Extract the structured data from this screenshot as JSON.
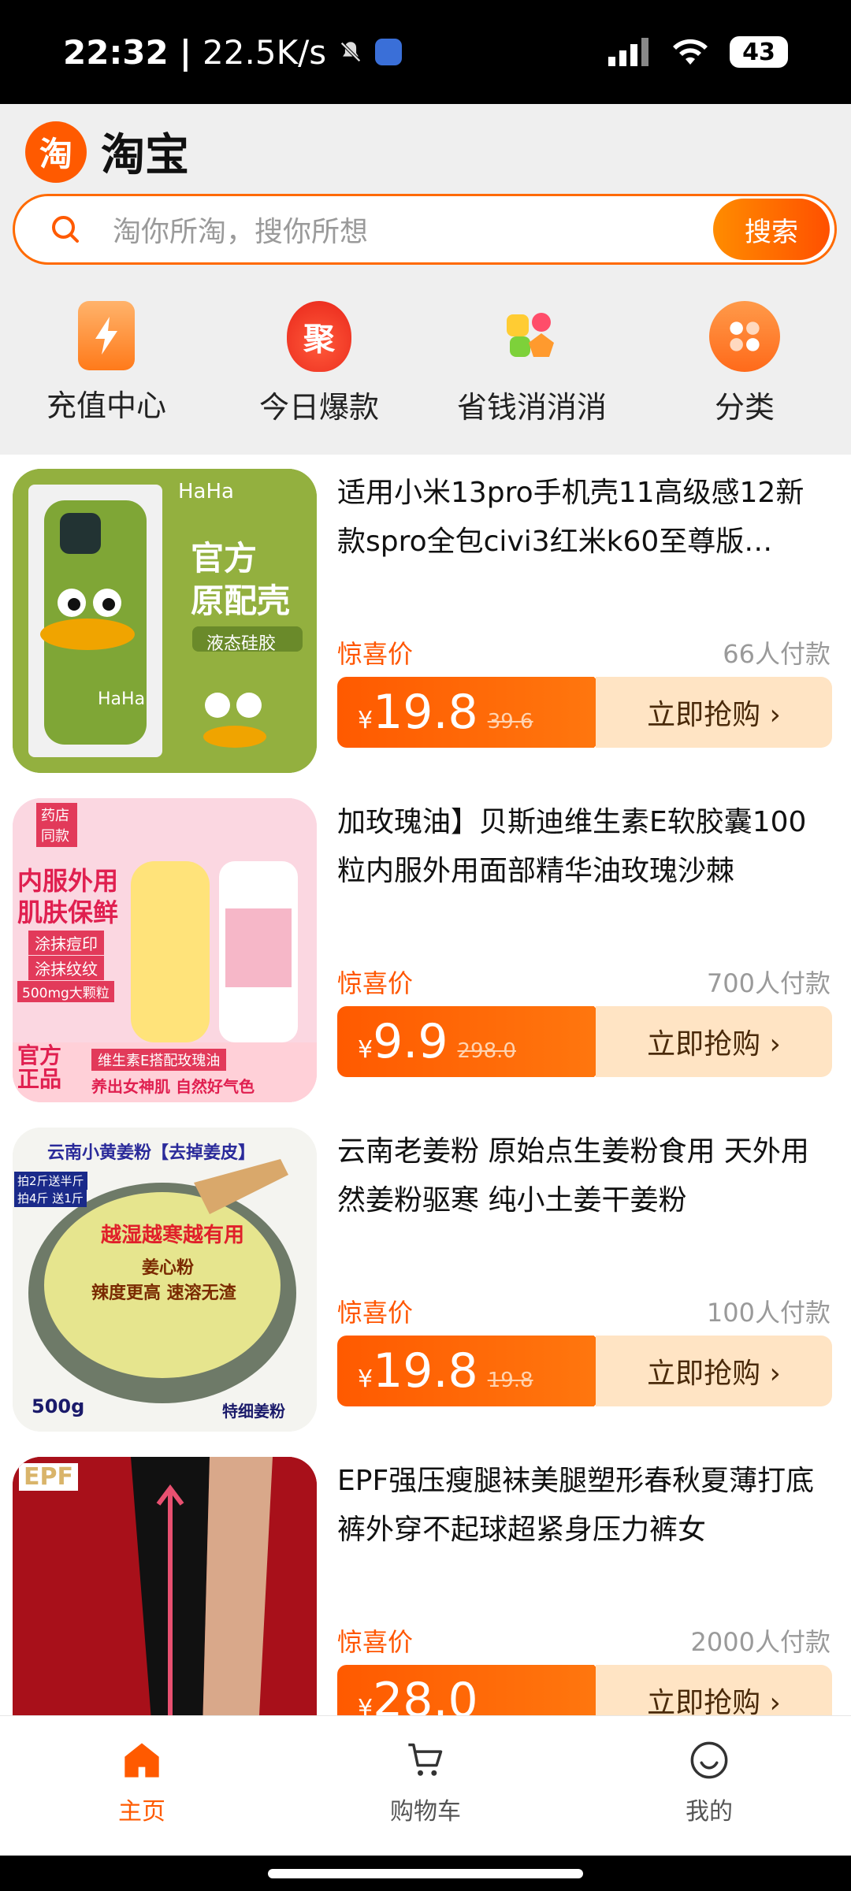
{
  "status_bar": {
    "time": "22:32",
    "speed": "22.5K/s",
    "battery": "43",
    "icons": [
      "mute-bell-icon",
      "app-icon",
      "signal-icon",
      "wifi-icon",
      "battery-icon"
    ]
  },
  "header": {
    "logo_char": "淘",
    "app_name": "淘宝"
  },
  "search": {
    "placeholder": "淘你所淘，搜你所想",
    "button": "搜索"
  },
  "quick_entries": [
    {
      "label": "充值中心",
      "icon": "lightning-card-icon"
    },
    {
      "label": "今日爆款",
      "icon": "hot-flame-icon",
      "icon_text": "聚"
    },
    {
      "label": "省钱消消消",
      "icon": "game-blocks-icon"
    },
    {
      "label": "分类",
      "icon": "category-grid-icon"
    }
  ],
  "products": [
    {
      "title": "适用小米13pro手机壳11高级感12新款spro全包civi3红米k60至尊版…",
      "tag": "惊喜价",
      "sold": "66人付款",
      "currency": "¥",
      "price": "19.8",
      "original_price": "39.6",
      "buy": "立即抢购 ›",
      "image_texts": [
        "HaHa",
        "官方",
        "原配壳",
        "液态硅胶",
        "HaHa"
      ]
    },
    {
      "title": "加玫瑰油】贝斯迪维生素E软胶囊100粒内服外用面部精华油玫瑰沙棘",
      "tag": "惊喜价",
      "sold": "700人付款",
      "currency": "¥",
      "price": "9.9",
      "original_price": "298.0",
      "buy": "立即抢购 ›",
      "image_texts": [
        "药店同款",
        "内服外用",
        "肌肤保鲜",
        "涂抹痘印",
        "涂抹纹纹",
        "500mg大颗粒",
        "官方正品",
        "维生素E搭配玫瑰油",
        "养出女神肌 自然好气色"
      ]
    },
    {
      "title": "云南老姜粉 原始点生姜粉食用 天外用然姜粉驱寒 纯小土姜干姜粉",
      "tag": "惊喜价",
      "sold": "100人付款",
      "currency": "¥",
      "price": "19.8",
      "original_price": "19.8",
      "buy": "立即抢购 ›",
      "image_texts": [
        "云南小黄姜粉【去掉姜皮】",
        "拍2斤送半斤",
        "拍4斤 送1斤",
        "越湿越寒越有用",
        "姜心粉",
        "辣度更高 速溶无渣",
        "500g",
        "特细姜粉"
      ]
    },
    {
      "title": "EPF强压瘦腿袜美腿塑形春秋夏薄打底裤外穿不起球超紧身压力裤女",
      "tag": "惊喜价",
      "sold": "2000人付款",
      "currency": "¥",
      "price": "28.0",
      "original_price": "",
      "buy": "立即抢购 ›",
      "image_texts": [
        "EPF"
      ]
    }
  ],
  "bottom_nav": [
    {
      "label": "主页",
      "icon": "home-icon",
      "active": true
    },
    {
      "label": "购物车",
      "icon": "cart-icon",
      "active": false
    },
    {
      "label": "我的",
      "icon": "smiley-face-icon",
      "active": false
    }
  ],
  "colors": {
    "accent": "#ff5a00",
    "buy_bg": "#ffe4c4",
    "tag": "#ff5500"
  }
}
